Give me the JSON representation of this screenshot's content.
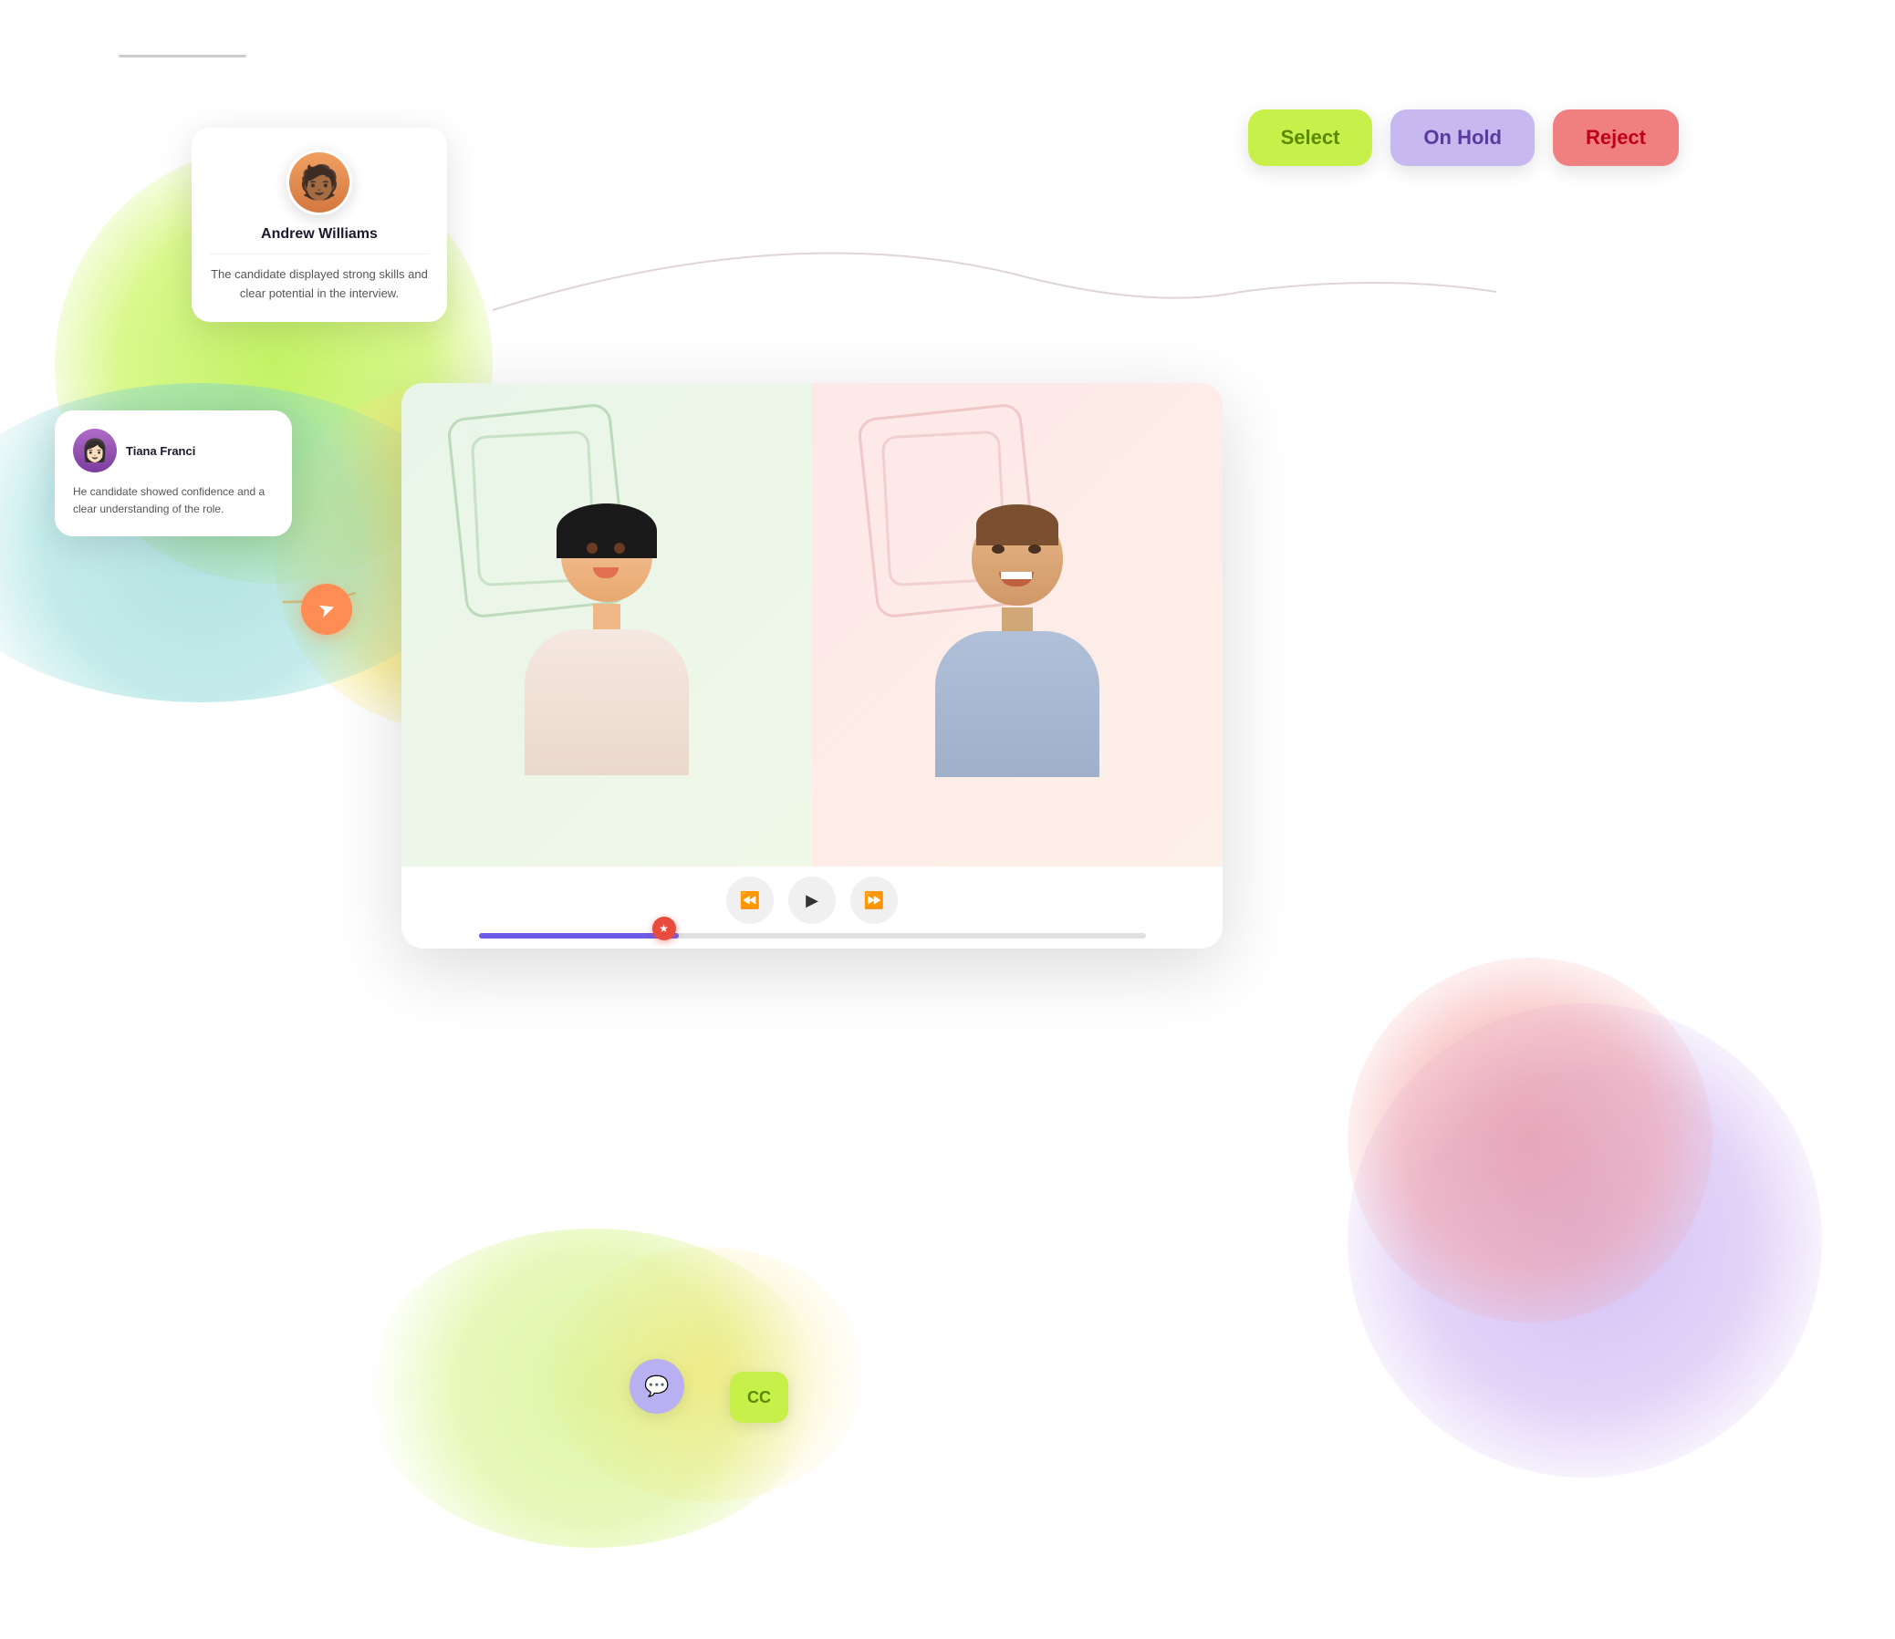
{
  "logo": {
    "line": ""
  },
  "candidate_card": {
    "name": "Andrew Williams",
    "feedback": "The candidate displayed strong skills and clear potential in the interview.",
    "avatar_emoji": "🧑🏾"
  },
  "reviewer_card": {
    "name": "Tiana Franci",
    "feedback": "He candidate showed confidence and a clear understanding of the role.",
    "avatar_emoji": "👩🏻‍🦰"
  },
  "status_buttons": {
    "select": "Select",
    "on_hold": "On Hold",
    "reject": "Reject"
  },
  "video_controls": {
    "rewind": "⏪",
    "play": "▶",
    "fast_forward": "⏩"
  },
  "cc_button": {
    "label": "CC"
  },
  "chat_button": {
    "label": "💬"
  },
  "send_icon": {
    "label": "➤"
  },
  "colors": {
    "select_bg": "#c8f04a",
    "select_text": "#4a8200",
    "on_hold_bg": "#c8b8f0",
    "on_hold_text": "#5a3a9e",
    "reject_bg": "#f08080",
    "reject_text": "#c0001a",
    "progress_fill": "#6c5ce7",
    "send_bg": "#ff8c52",
    "chat_bg": "#b8b0f0",
    "cc_bg": "#c8f04a"
  }
}
